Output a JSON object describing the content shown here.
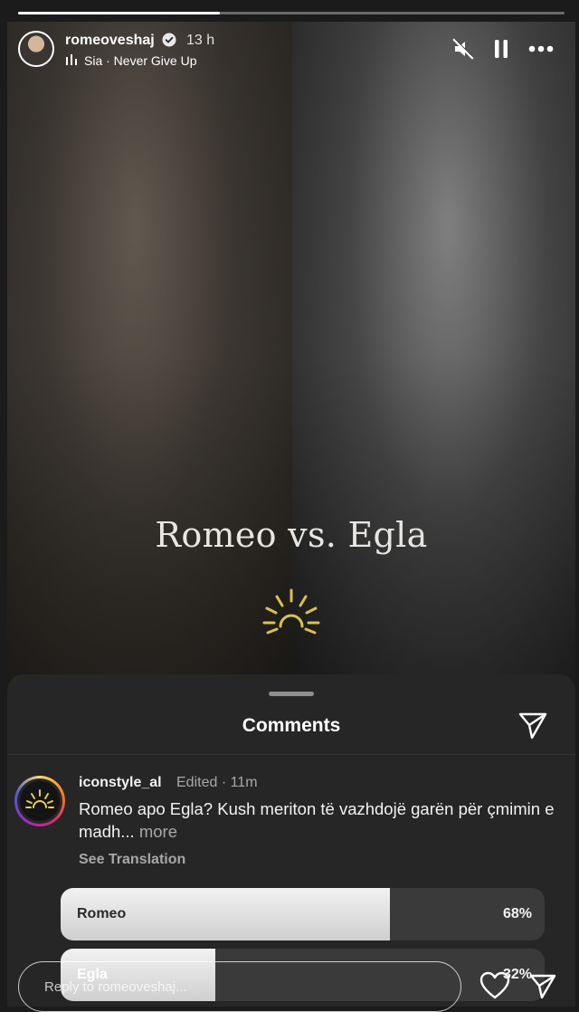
{
  "story": {
    "progress": 0.37,
    "overlay_title": "Romeo vs. Egla"
  },
  "header": {
    "username": "romeoveshaj",
    "verified_icon": "verified-badge-icon",
    "time": "13 h",
    "music": "Sia · Never Give Up",
    "icons": [
      "music-bars-icon",
      "mute-icon",
      "pause-icon",
      "more-icon"
    ]
  },
  "comments": {
    "title": "Comments",
    "share_icon": "send-icon",
    "comment": {
      "user": "iconstyle_al",
      "meta": "Edited · 11m",
      "text": "Romeo apo Egla? Kush meriton të vazhdojë garën për çmimin e madh...",
      "more": "more",
      "see_translation": "See Translation"
    },
    "poll": [
      {
        "label": "Romeo",
        "percent": "68%",
        "fraction": 0.68
      },
      {
        "label": "Egla",
        "percent": "32%",
        "fraction": 0.32
      }
    ]
  },
  "reply": {
    "placeholder": "Reply to romeoveshaj...",
    "icons": [
      "heart-icon",
      "send-icon"
    ]
  },
  "colors": {
    "sheet_bg": "#262626",
    "logo_gold": "#d8c24a"
  }
}
